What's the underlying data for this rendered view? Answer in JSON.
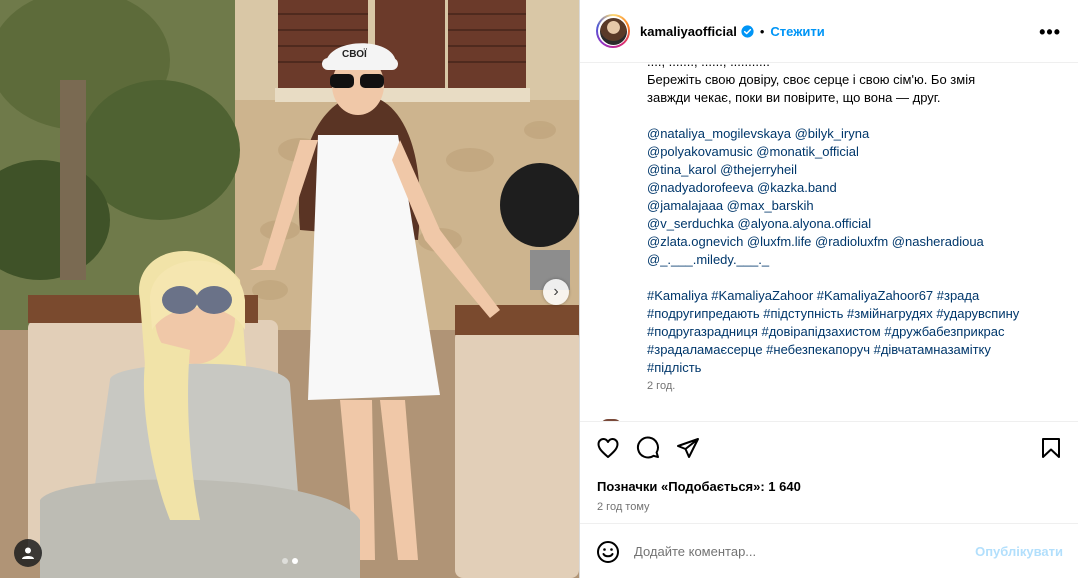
{
  "header": {
    "username": "kamaliyaofficial",
    "separator": "•",
    "follow_label": "Стежити",
    "more_label": "•••"
  },
  "caption": {
    "cut_line": "...., ......., ......, ...........",
    "line1": "Бережіть свою довіру, своє серце і свою сім'ю. Бо змія",
    "line2": "завжди чекає, поки ви повірите, що вона — друг.",
    "mentions": [
      "@nataliya_mogilevskaya @bilyk_iryna",
      "@polyakovamusic @monatik_official",
      "@tina_karol @thejerryheil",
      "@nadyadorofeeva @kazka.band",
      "@jamalajaaa @max_barskih",
      "@v_serduchka @alyona.alyona.official",
      "@zlata.ognevich @luxfm.life @radioluxfm @nasheradioua",
      "@_.___.miledy.___._"
    ],
    "hashtags": [
      "#Kamaliya #KamaliyaZahoor #KamaliyaZahoor67 #зрада",
      "#подругипредають #підступність #змійнагрудях #ударувспину",
      "#подругазрадниця #довірапідзахистом #дружбабезприкрас",
      "#зрадаламаєсерце #небезпекапоруч #дівчатамназамітку",
      "#підлість"
    ],
    "time": "2 год."
  },
  "actions": {
    "likes": "Позначки «Подобається»: 1 640",
    "time_ago": "2 год тому"
  },
  "comment": {
    "placeholder": "Додайте коментар...",
    "publish_label": "Опублікувати"
  },
  "photo": {
    "hat_text": "СВОЇ"
  },
  "colors": {
    "link": "#00376b",
    "follow": "#0095f6",
    "publish_disabled": "#b2dffc"
  }
}
